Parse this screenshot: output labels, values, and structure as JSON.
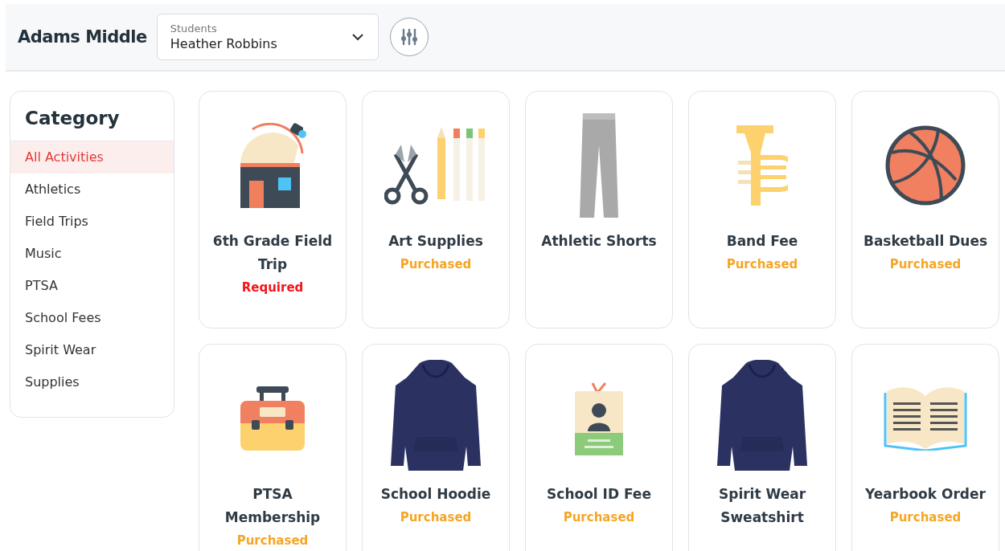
{
  "header": {
    "school": "Adams Middle",
    "student_select": {
      "label": "Students",
      "value": "Heather Robbins"
    }
  },
  "sidebar": {
    "title": "Category",
    "items": [
      {
        "label": "All Activities",
        "selected": true
      },
      {
        "label": "Athletics",
        "selected": false
      },
      {
        "label": "Field Trips",
        "selected": false
      },
      {
        "label": "Music",
        "selected": false
      },
      {
        "label": "PTSA",
        "selected": false
      },
      {
        "label": "School Fees",
        "selected": false
      },
      {
        "label": "Spirit Wear",
        "selected": false
      },
      {
        "label": "Supplies",
        "selected": false
      }
    ]
  },
  "activities": [
    {
      "kind": "observatory",
      "title": "6th Grade Field Trip",
      "status": "Required",
      "required": true
    },
    {
      "kind": "art",
      "title": "Art Supplies",
      "status": "Purchased",
      "required": false
    },
    {
      "kind": "pants",
      "title": "Athletic Shorts"
    },
    {
      "kind": "trumpet",
      "title": "Band Fee",
      "status": "Purchased",
      "required": false
    },
    {
      "kind": "basketball",
      "title": "Basketball Dues",
      "status": "Purchased",
      "required": false
    },
    {
      "kind": "bag",
      "title": "PTSA Membership",
      "status": "Purchased",
      "required": false
    },
    {
      "kind": "hoodie",
      "title": "School Hoodie",
      "status": "Purchased",
      "required": false
    },
    {
      "kind": "idcard",
      "title": "School ID Fee",
      "status": "Purchased",
      "required": false
    },
    {
      "kind": "hoodie",
      "title": "Spirit Wear Sweatshirt"
    },
    {
      "kind": "book",
      "title": "Yearbook Order",
      "status": "Purchased",
      "required": false
    }
  ]
}
